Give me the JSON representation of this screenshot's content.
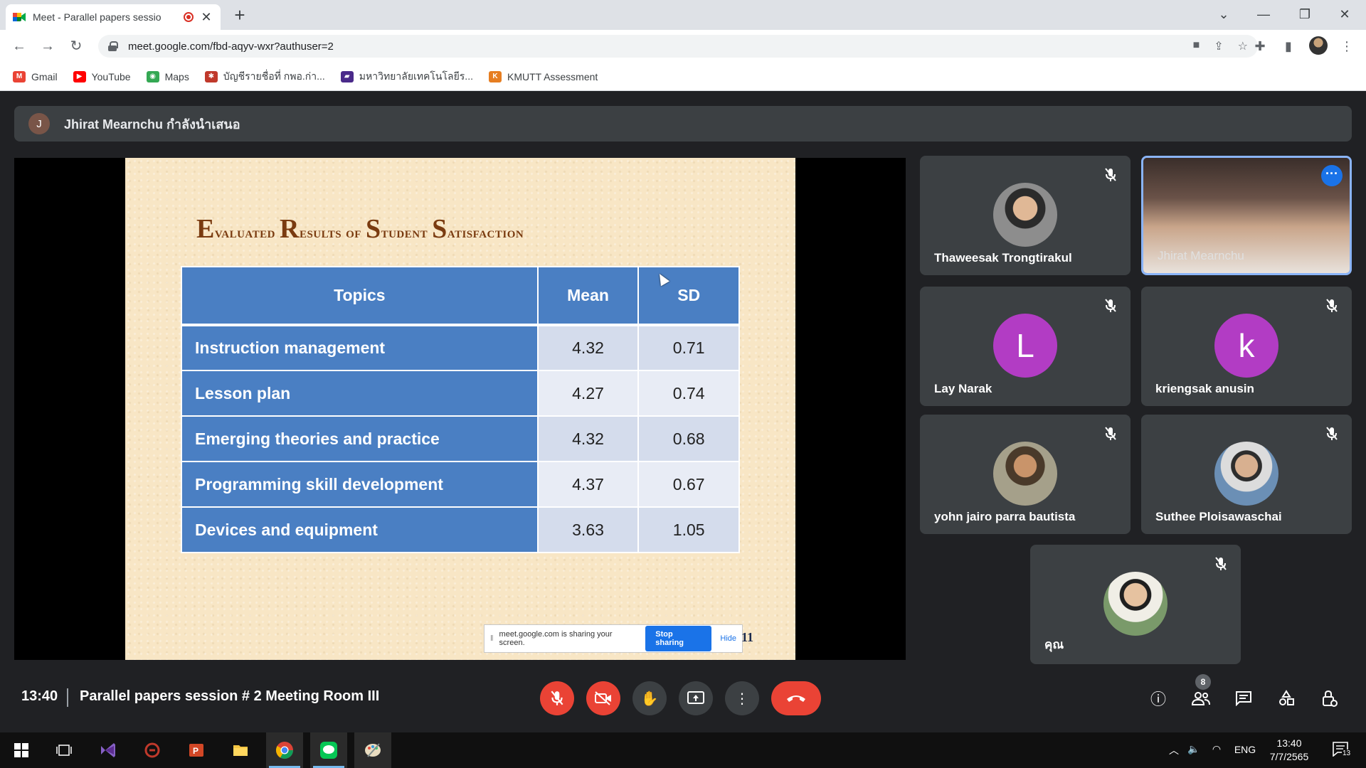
{
  "browser": {
    "tab_title": "Meet - Parallel papers sessio",
    "url": "meet.google.com/fbd-aqyv-wxr?authuser=2",
    "bookmarks": [
      {
        "label": "Gmail",
        "color": "#ea4335",
        "glyph": "M"
      },
      {
        "label": "YouTube",
        "color": "#ff0000",
        "glyph": "▶"
      },
      {
        "label": "Maps",
        "color": "#34a853",
        "glyph": "◉"
      },
      {
        "label": "บัญชีรายชื่อที่ กพอ.ก่า...",
        "color": "#c0392b",
        "glyph": "✱"
      },
      {
        "label": "มหาวิทยาลัยเทคโนโลยีร...",
        "color": "#4a2a8a",
        "glyph": "▰"
      },
      {
        "label": "KMUTT Assessment",
        "color": "#e67e22",
        "glyph": "K"
      }
    ]
  },
  "presenter": {
    "initial": "J",
    "text": "Jhirat Mearnchu กำลังนำเสนอ"
  },
  "slide": {
    "title_words": [
      {
        "cap": "E",
        "rest": "valuated"
      },
      {
        "cap": "R",
        "rest": "esults"
      },
      {
        "cap": "",
        "rest": "of"
      },
      {
        "cap": "S",
        "rest": "tudent"
      },
      {
        "cap": "S",
        "rest": "atisfaction"
      }
    ],
    "table": {
      "headers": [
        "Topics",
        "Mean",
        "SD"
      ],
      "rows": [
        [
          "Instruction management",
          "4.32",
          "0.71"
        ],
        [
          "Lesson plan",
          "4.27",
          "0.74"
        ],
        [
          "Emerging theories and practice",
          "4.32",
          "0.68"
        ],
        [
          "Programming skill development",
          "4.37",
          "0.67"
        ],
        [
          "Devices and equipment",
          "3.63",
          "1.05"
        ]
      ]
    },
    "page_number": "11",
    "share_notice": {
      "text": "meet.google.com is sharing your screen.",
      "stop_label": "Stop sharing",
      "hide_label": "Hide"
    }
  },
  "participants": [
    {
      "name": "Thaweesak Trongtirakul",
      "initial": "",
      "color": ""
    },
    {
      "name": "Jhirat Mearnchu",
      "initial": "",
      "color": ""
    },
    {
      "name": "Lay Narak",
      "initial": "L",
      "color": "#b23cc4"
    },
    {
      "name": "kriengsak anusin",
      "initial": "k",
      "color": "#b23cc4"
    },
    {
      "name": "yohn jairo parra bautista",
      "initial": "",
      "color": ""
    },
    {
      "name": "Suthee Ploisawaschai",
      "initial": "",
      "color": ""
    },
    {
      "name": "คุณ",
      "initial": "",
      "color": ""
    }
  ],
  "meeting": {
    "time": "13:40",
    "title": "Parallel papers session # 2 Meeting Room III",
    "people_count": "8"
  },
  "system_tray": {
    "language": "ENG",
    "clock_time": "13:40",
    "clock_date": "7/7/2565",
    "notification_count": "13"
  }
}
